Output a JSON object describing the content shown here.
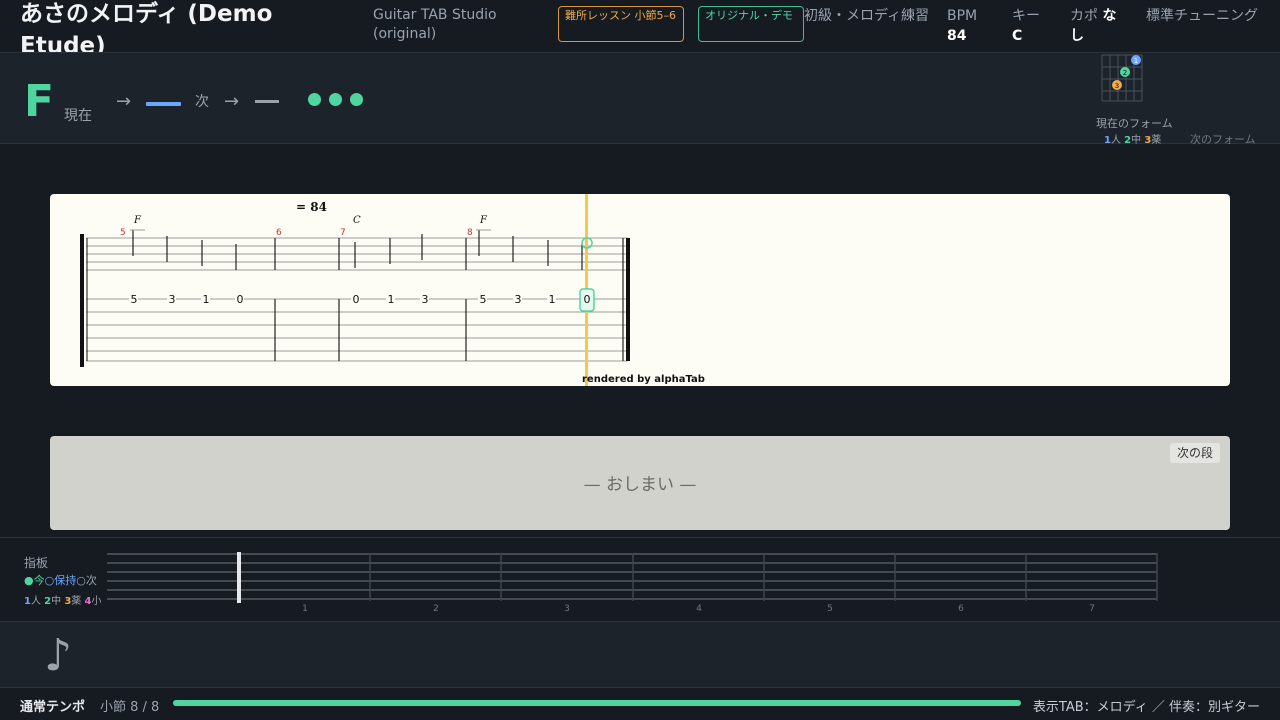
{
  "header": {
    "song_title": "あさのメロディ (Demo Etude)",
    "app_name": "Guitar TAB Studio (original)",
    "lesson_badge": "難所レッスン 小節5–6",
    "original_badge": "オリジナル・デモ",
    "level": "初級・メロディ練習",
    "bpm_label": "BPM",
    "bpm_value": "84",
    "key_label": "キー",
    "key_value": "C",
    "capo_label": "カポ",
    "capo_value": "なし",
    "tuning": "標準チューニング"
  },
  "chord_bar": {
    "current_chord": "F",
    "current_label": "現在",
    "arrow": "→",
    "next_label": "次",
    "current_form_label": "現在のフォーム",
    "finger_1": "1",
    "finger_1_label": "人",
    "finger_2": "2",
    "finger_2_label": "中",
    "finger_3": "3",
    "finger_3_label": "薬",
    "next_form_label": "次のフォーム",
    "diagram_dots": [
      "1",
      "2",
      "3"
    ]
  },
  "score": {
    "tempo_marking": "= 84",
    "chords": [
      "F",
      "C",
      "F"
    ],
    "measure_numbers": [
      "5",
      "6",
      "7",
      "8"
    ],
    "tab_numbers": [
      "5",
      "3",
      "1",
      "0",
      "0",
      "1",
      "3",
      "5",
      "3",
      "1",
      "0"
    ],
    "rendered_by": "rendered by alphaTab"
  },
  "next_section": {
    "the_end": "— おしまい —",
    "next_button": "次の段"
  },
  "fretboard": {
    "title": "指板",
    "legend_now": "●今",
    "legend_hold": "○保持",
    "legend_next": "○次",
    "fret_numbers": [
      "1",
      "2",
      "3",
      "4",
      "5",
      "6",
      "7"
    ]
  },
  "status": {
    "tempo_mode": "通常テンポ",
    "measure": "小節 8 / 8",
    "progress": 1.0,
    "tab_display": "表示TAB：メロディ ／ 伴奏：別ギター"
  },
  "colors": {
    "accent_green": "#4fd6a0",
    "accent_blue": "#6aa6ff",
    "accent_orange": "#f2a94f",
    "playhead": "#f5c84a"
  },
  "icons": {
    "note": "eighth-note-icon"
  }
}
